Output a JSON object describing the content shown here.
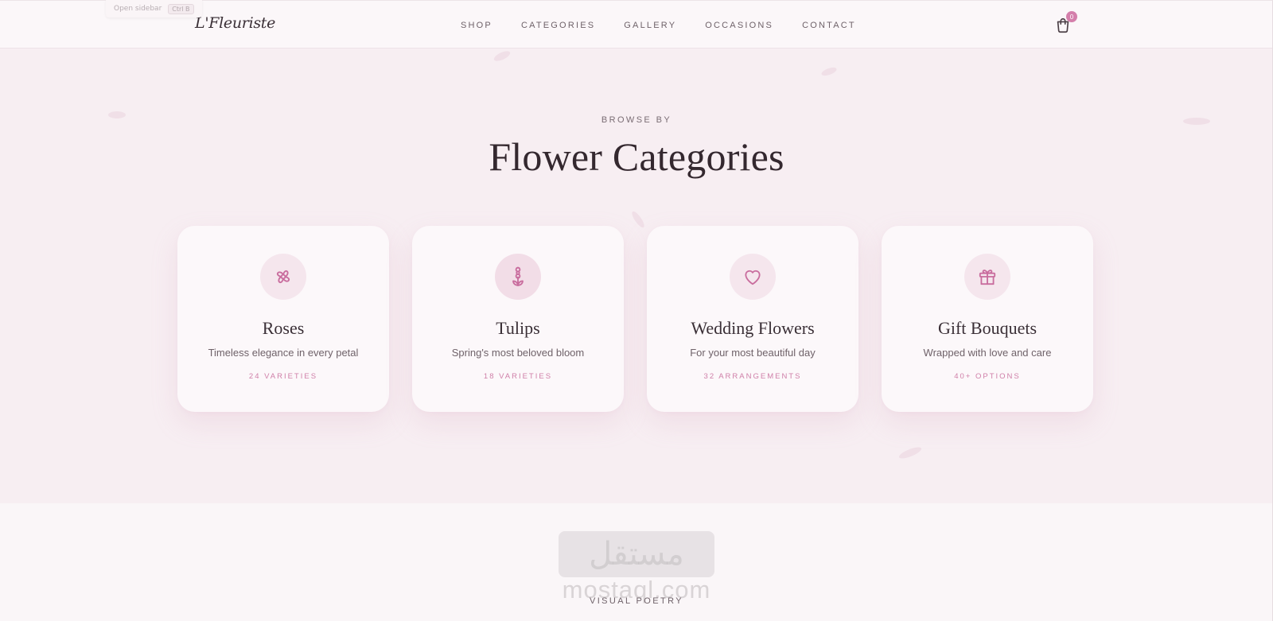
{
  "hint": {
    "label": "Open sidebar",
    "shortcut": "Ctrl B"
  },
  "brand": {
    "logo": "L'Fleuriste"
  },
  "nav": {
    "items": [
      {
        "label": "SHOP"
      },
      {
        "label": "CATEGORIES"
      },
      {
        "label": "GALLERY"
      },
      {
        "label": "OCCASIONS"
      },
      {
        "label": "CONTACT"
      }
    ],
    "cart": {
      "icon": "shopping-bag-icon",
      "count": "0"
    }
  },
  "categories": {
    "eyebrow": "BROWSE BY",
    "title": "Flower Categories",
    "cards": [
      {
        "icon": "flower-icon",
        "name": "Roses",
        "description": "Timeless elegance in every petal",
        "meta": "24 VARIETIES"
      },
      {
        "icon": "tulip-icon",
        "name": "Tulips",
        "description": "Spring's most beloved bloom",
        "meta": "18 VARIETIES"
      },
      {
        "icon": "heart-icon",
        "name": "Wedding Flowers",
        "description": "For your most beautiful day",
        "meta": "32 ARRANGEMENTS"
      },
      {
        "icon": "gift-icon",
        "name": "Gift Bouquets",
        "description": "Wrapped with love and care",
        "meta": "40+ OPTIONS"
      }
    ]
  },
  "gallery": {
    "eyebrow": "VISUAL POETRY"
  },
  "watermark": {
    "text_ar": "مستقل",
    "text_en": "mostaql.com"
  },
  "colors": {
    "accent": "#d47fab",
    "background": "#f7eef2",
    "card": "#fcf8fa"
  }
}
